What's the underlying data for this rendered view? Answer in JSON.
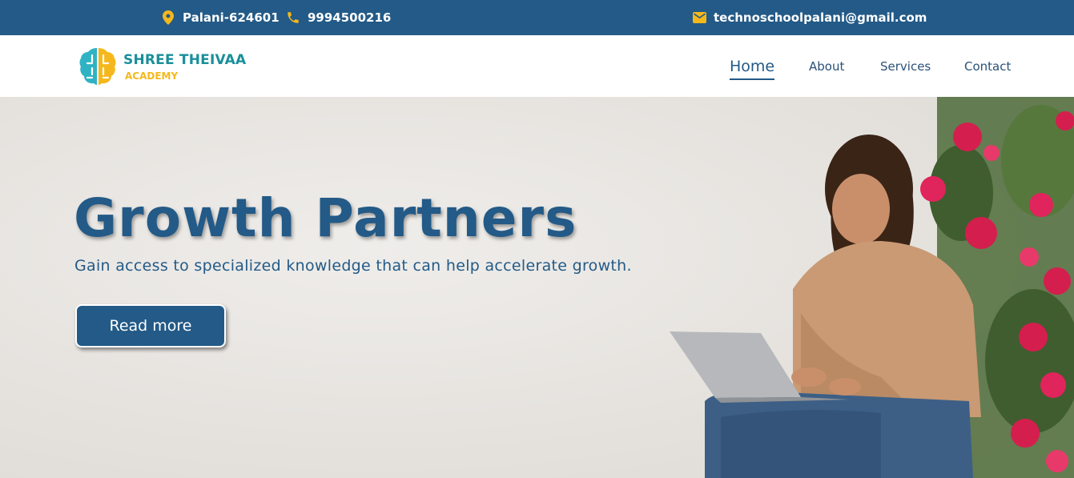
{
  "topbar": {
    "location": "Palani-624601",
    "phone": "9994500216",
    "email": "technoschoolpalani@gmail.com"
  },
  "brand": {
    "name": "SHREE THEIVAA",
    "tagline": "ACADEMY"
  },
  "nav": {
    "items": [
      "Home",
      "About",
      "Services",
      "Contact"
    ],
    "active": "Home"
  },
  "hero": {
    "title": "Growth Partners",
    "subtitle": "Gain access to specialized knowledge that can help accelerate growth.",
    "button_label": "Read more"
  },
  "icons": {
    "location": "map-pin-icon",
    "phone": "phone-icon",
    "email": "mail-icon"
  },
  "colors": {
    "primary": "#235a87",
    "accent": "#f5b81c",
    "brand_teal": "#1a8f9a",
    "hero_background": "#e6e3df"
  }
}
